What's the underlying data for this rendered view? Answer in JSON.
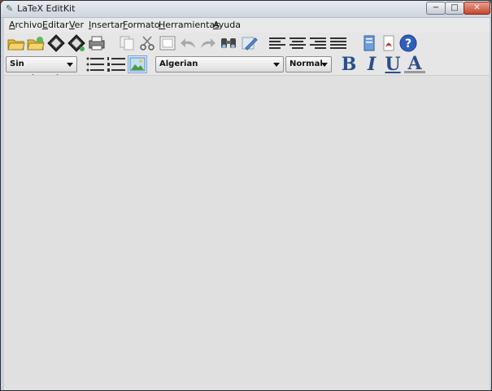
{
  "window": {
    "title": "LaTeX EditKit"
  },
  "window_controls": {
    "minimize": "−",
    "maximize": "□",
    "close": "✕"
  },
  "menubar": {
    "items": [
      {
        "mnemonic": "A",
        "rest": "rchivo"
      },
      {
        "mnemonic": "E",
        "rest": "ditar"
      },
      {
        "mnemonic": "V",
        "rest": "er"
      },
      {
        "mnemonic": "I",
        "rest": "nsertar"
      },
      {
        "mnemonic": "F",
        "rest": "ormato"
      },
      {
        "mnemonic": "H",
        "rest": "erramientas"
      },
      {
        "mnemonic": "A",
        "rest": "yuda"
      }
    ]
  },
  "format_bar": {
    "heading_select": "Sin encabezado",
    "font_select": "Algerian",
    "size_select": "Normal",
    "bold": "B",
    "italic": "I",
    "underline": "U",
    "font_color": "A"
  },
  "colors": {
    "help_icon": "#2f5fc0",
    "pdf_icon": "#c0392b",
    "folder": "#e3b93a"
  }
}
